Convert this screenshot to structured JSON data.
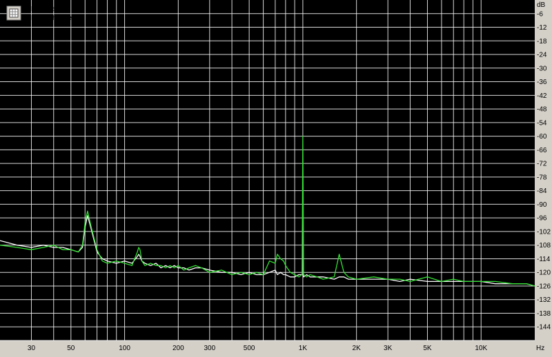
{
  "chart_data": {
    "type": "line",
    "x_scale": "log",
    "y_unit": "dB",
    "x_unit": "Hz",
    "x_range": [
      20,
      20000
    ],
    "y_range": [
      -150,
      0
    ],
    "grid": true,
    "legend_position": "top-left",
    "background_color": "#000000",
    "grid_color": "#ffffff",
    "y_ticks": [
      -6,
      -12,
      -18,
      -24,
      -30,
      -36,
      -42,
      -48,
      -54,
      -60,
      -66,
      -72,
      -78,
      -84,
      -90,
      -96,
      -102,
      -108,
      -114,
      -120,
      -126,
      -132,
      -138,
      -144
    ],
    "x_ticks": [
      {
        "value": 30,
        "label": "30"
      },
      {
        "value": 50,
        "label": "50"
      },
      {
        "value": 100,
        "label": "100"
      },
      {
        "value": 200,
        "label": "200"
      },
      {
        "value": 300,
        "label": "300"
      },
      {
        "value": 500,
        "label": "500"
      },
      {
        "value": 1000,
        "label": "1K"
      },
      {
        "value": 2000,
        "label": "2K"
      },
      {
        "value": 3000,
        "label": "3K"
      },
      {
        "value": 5000,
        "label": "5K"
      },
      {
        "value": 10000,
        "label": "10K"
      }
    ],
    "series": [
      {
        "name": "Left channel",
        "color": "#ffffff",
        "x": [
          20,
          25,
          30,
          35,
          40,
          45,
          50,
          55,
          58,
          60,
          62,
          65,
          70,
          75,
          80,
          90,
          100,
          110,
          118,
          120,
          122,
          125,
          130,
          140,
          150,
          160,
          170,
          180,
          190,
          200,
          215,
          230,
          250,
          270,
          300,
          350,
          400,
          450,
          500,
          550,
          600,
          650,
          700,
          720,
          750,
          780,
          800,
          850,
          900,
          950,
          990,
          1000,
          1010,
          1050,
          1100,
          1200,
          1300,
          1500,
          1600,
          1700,
          1800,
          2000,
          2500,
          3000,
          3500,
          4000,
          5000,
          6000,
          7000,
          8000,
          10000,
          12000,
          15000,
          18000,
          20000
        ],
        "y": [
          -106,
          -108,
          -109,
          -108,
          -109,
          -109,
          -110,
          -111,
          -109,
          -100,
          -95,
          -101,
          -111,
          -114,
          -115,
          -116,
          -115,
          -116,
          -113,
          -112,
          -113,
          -115,
          -116,
          -117,
          -116,
          -118,
          -117,
          -118,
          -117,
          -118,
          -118,
          -119,
          -118,
          -118,
          -119,
          -120,
          -120,
          -121,
          -120,
          -121,
          -121,
          -120,
          -119,
          -121,
          -120,
          -121,
          -121,
          -122,
          -122,
          -121,
          -121,
          -121,
          -122,
          -121,
          -122,
          -122,
          -122,
          -123,
          -122,
          -122,
          -123,
          -123,
          -123,
          -123,
          -124,
          -123,
          -124,
          -124,
          -124,
          -124,
          -124,
          -125,
          -125,
          -125,
          -126
        ]
      },
      {
        "name": "Right channel",
        "color": "#33e233",
        "x": [
          20,
          25,
          30,
          35,
          40,
          45,
          50,
          55,
          58,
          60,
          62,
          65,
          70,
          75,
          80,
          90,
          100,
          110,
          118,
          120,
          122,
          125,
          130,
          140,
          150,
          160,
          170,
          180,
          190,
          200,
          215,
          230,
          250,
          270,
          300,
          350,
          400,
          450,
          500,
          550,
          600,
          650,
          700,
          720,
          750,
          780,
          800,
          850,
          900,
          950,
          990,
          1000,
          1010,
          1050,
          1100,
          1200,
          1300,
          1500,
          1600,
          1700,
          1800,
          2000,
          2500,
          3000,
          3500,
          4000,
          5000,
          6000,
          7000,
          8000,
          10000,
          12000,
          15000,
          18000,
          20000
        ],
        "y": [
          -108,
          -109,
          -110,
          -109,
          -108,
          -110,
          -110,
          -111,
          -108,
          -98,
          -93,
          -100,
          -110,
          -115,
          -116,
          -115,
          -116,
          -117,
          -111,
          -109,
          -110,
          -115,
          -117,
          -116,
          -117,
          -117,
          -118,
          -117,
          -118,
          -117,
          -119,
          -118,
          -117,
          -118,
          -120,
          -119,
          -121,
          -120,
          -121,
          -120,
          -121,
          -115,
          -116,
          -112,
          -114,
          -115,
          -117,
          -120,
          -121,
          -122,
          -121,
          -60,
          -121,
          -122,
          -121,
          -122,
          -123,
          -122,
          -112,
          -120,
          -122,
          -123,
          -122,
          -123,
          -123,
          -124,
          -122,
          -124,
          -123,
          -124,
          -124,
          -124,
          -125,
          -125,
          -126
        ]
      }
    ]
  }
}
